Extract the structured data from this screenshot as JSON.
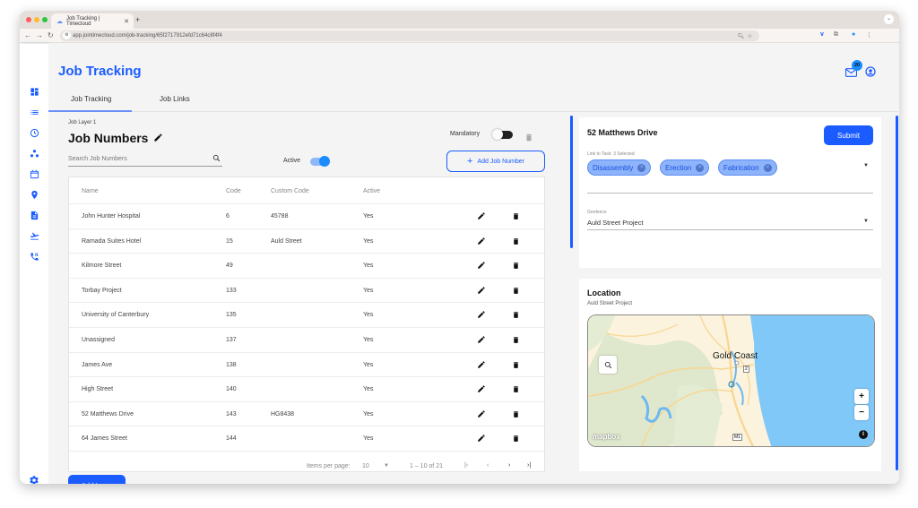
{
  "browser": {
    "tab_title": "Job Tracking | Timecloud",
    "url": "app.jointimecloud.com/job-tracking/65f2717912efd71c64c8f4f4"
  },
  "app": {
    "page_title": "Job Tracking",
    "notifications_count": "20",
    "colors": {
      "accent": "#1a5cff",
      "chip_bg": "#8db3fb"
    }
  },
  "sidebar": {
    "items": [
      {
        "icon": "dashboard-icon"
      },
      {
        "icon": "list-icon"
      },
      {
        "icon": "clock-icon"
      },
      {
        "icon": "hierarchy-icon"
      },
      {
        "icon": "calendar-icon"
      },
      {
        "icon": "location-pin-icon"
      },
      {
        "icon": "document-icon"
      },
      {
        "icon": "flight-takeoff-icon"
      },
      {
        "icon": "phone-forward-icon"
      }
    ],
    "settings_icon": "gear-icon"
  },
  "tabs": [
    {
      "label": "Job Tracking",
      "active": true
    },
    {
      "label": "Job Links",
      "active": false
    }
  ],
  "job_layer": {
    "layer_label": "Job Layer 1",
    "title": "Job Numbers",
    "search_placeholder": "Search Job Numbers",
    "active_label": "Active",
    "active_on": true,
    "mandatory_label": "Mandatory",
    "mandatory_on": false,
    "add_button": "Add Job Number",
    "columns": [
      "Name",
      "Code",
      "Custom Code",
      "Active"
    ],
    "rows": [
      {
        "name": "John Hunter Hospital",
        "code": "6",
        "custom": "45788",
        "active": "Yes"
      },
      {
        "name": "Ramada Suites Hotel",
        "code": "15",
        "custom": "Auld Street",
        "active": "Yes"
      },
      {
        "name": "Kilmore Street",
        "code": "49",
        "custom": "",
        "active": "Yes"
      },
      {
        "name": "Torbay Project",
        "code": "133",
        "custom": "",
        "active": "Yes"
      },
      {
        "name": "University of Canterbury",
        "code": "135",
        "custom": "",
        "active": "Yes"
      },
      {
        "name": "Unassigned",
        "code": "137",
        "custom": "",
        "active": "Yes"
      },
      {
        "name": "James Ave",
        "code": "138",
        "custom": "",
        "active": "Yes"
      },
      {
        "name": "High Street",
        "code": "140",
        "custom": "",
        "active": "Yes"
      },
      {
        "name": "52 Matthews Drive",
        "code": "143",
        "custom": "HG8438",
        "active": "Yes"
      },
      {
        "name": "64 James Street",
        "code": "144",
        "custom": "",
        "active": "Yes"
      }
    ],
    "paginator": {
      "items_per_page_label": "Items per page:",
      "items_per_page": "10",
      "range": "1 – 10 of 21"
    },
    "add_layer_button": "Add Layer"
  },
  "detail": {
    "title": "52 Matthews Drive",
    "submit": "Submit",
    "link_label": "Link to Task: 3 Selected",
    "chips": [
      "Disassembly",
      "Erection",
      "Fabrication"
    ],
    "geofence_label": "Geofence",
    "geofence_value": "Auld Street Project"
  },
  "location": {
    "title": "Location",
    "subtitle": "Auld Street Project",
    "map_city": "Gold Coast",
    "map_brand": "mapbox",
    "road_labels": [
      "2",
      "M1"
    ]
  }
}
